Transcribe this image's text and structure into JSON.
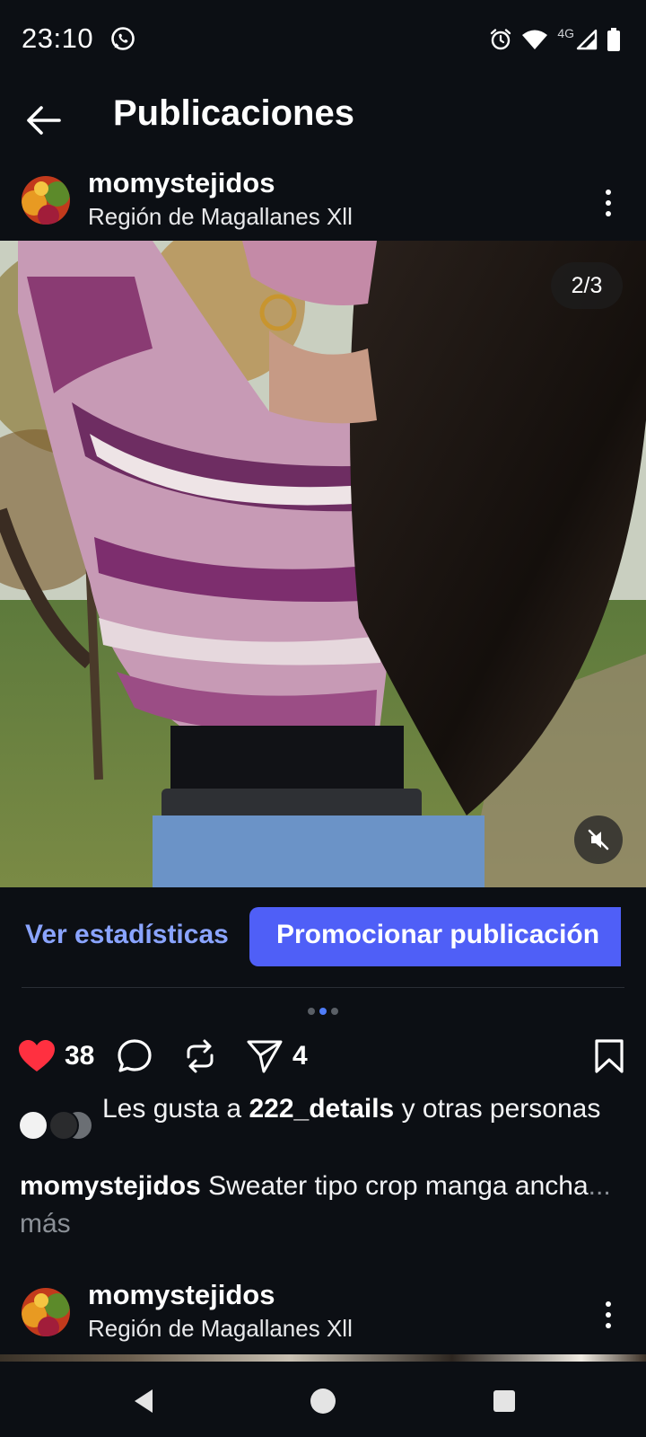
{
  "status": {
    "time": "23:10",
    "network": "4G"
  },
  "header": {
    "title": "Publicaciones"
  },
  "post": {
    "username": "momystejidos",
    "location": "Región de Magallanes Xll",
    "image_counter": "2/3",
    "carousel": {
      "total": 3,
      "active": 2
    },
    "actions": {
      "stats_label": "Ver estadísticas",
      "promote_label": "Promocionar publicación"
    },
    "likes_count": "38",
    "shares_count": "4",
    "liked_by": {
      "prefix": "Les gusta a ",
      "user": "222_details",
      "suffix": " y otras personas"
    },
    "caption": {
      "username": "momystejidos",
      "text": " Sweater tipo crop manga ancha",
      "more": "... más"
    }
  },
  "next_post": {
    "username": "momystejidos",
    "location": "Región de Magallanes Xll"
  },
  "icons": {
    "back": "arrow-left-icon",
    "more": "vertical-dots-icon",
    "like": "heart-icon",
    "comment": "speech-bubble-icon",
    "repost": "repost-icon",
    "share": "paper-plane-icon",
    "save": "bookmark-icon",
    "mute": "muted-speaker-icon"
  },
  "colors": {
    "background": "#0c0f14",
    "accent": "#4f5ff7",
    "link": "#8aa4ff",
    "like": "#ff3040"
  }
}
